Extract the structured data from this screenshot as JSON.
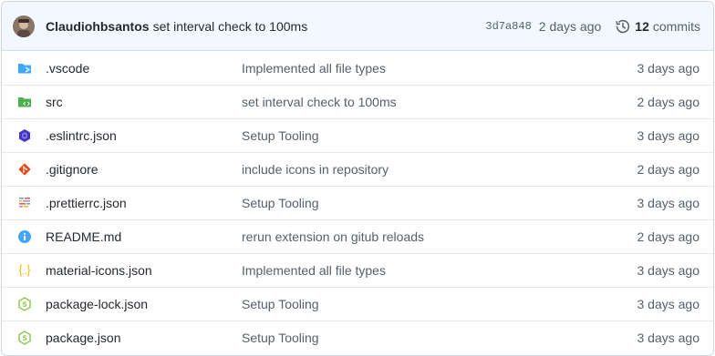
{
  "header": {
    "author": "Claudiohbsantos",
    "message": "set interval check to 100ms",
    "sha": "3d7a848",
    "age": "2 days ago",
    "commit_count": "12",
    "commit_label": "commits"
  },
  "files": [
    {
      "name": ".vscode",
      "message": "Implemented all file types",
      "age": "3 days ago",
      "icon": "vscode-folder-icon"
    },
    {
      "name": "src",
      "message": "set interval check to 100ms",
      "age": "2 days ago",
      "icon": "src-folder-icon"
    },
    {
      "name": ".eslintrc.json",
      "message": "Setup Tooling",
      "age": "3 days ago",
      "icon": "eslint-icon"
    },
    {
      "name": ".gitignore",
      "message": "include icons in repository",
      "age": "2 days ago",
      "icon": "git-icon"
    },
    {
      "name": ".prettierrc.json",
      "message": "Setup Tooling",
      "age": "3 days ago",
      "icon": "prettier-icon"
    },
    {
      "name": "README.md",
      "message": "rerun extension on gitub reloads",
      "age": "2 days ago",
      "icon": "info-icon"
    },
    {
      "name": "material-icons.json",
      "message": "Implemented all file types",
      "age": "3 days ago",
      "icon": "json-icon"
    },
    {
      "name": "package-lock.json",
      "message": "Setup Tooling",
      "age": "3 days ago",
      "icon": "nodejs-icon"
    },
    {
      "name": "package.json",
      "message": "Setup Tooling",
      "age": "3 days ago",
      "icon": "nodejs-icon"
    }
  ],
  "colors": {
    "header_bg": "#f1f8ff",
    "folder_blue": "#42a5f5",
    "folder_green": "#4caf50",
    "eslint": "#4b32c3",
    "git": "#e64a19",
    "info": "#42a5f5",
    "json": "#fbc02d",
    "nodejs": "#8bc34a"
  }
}
